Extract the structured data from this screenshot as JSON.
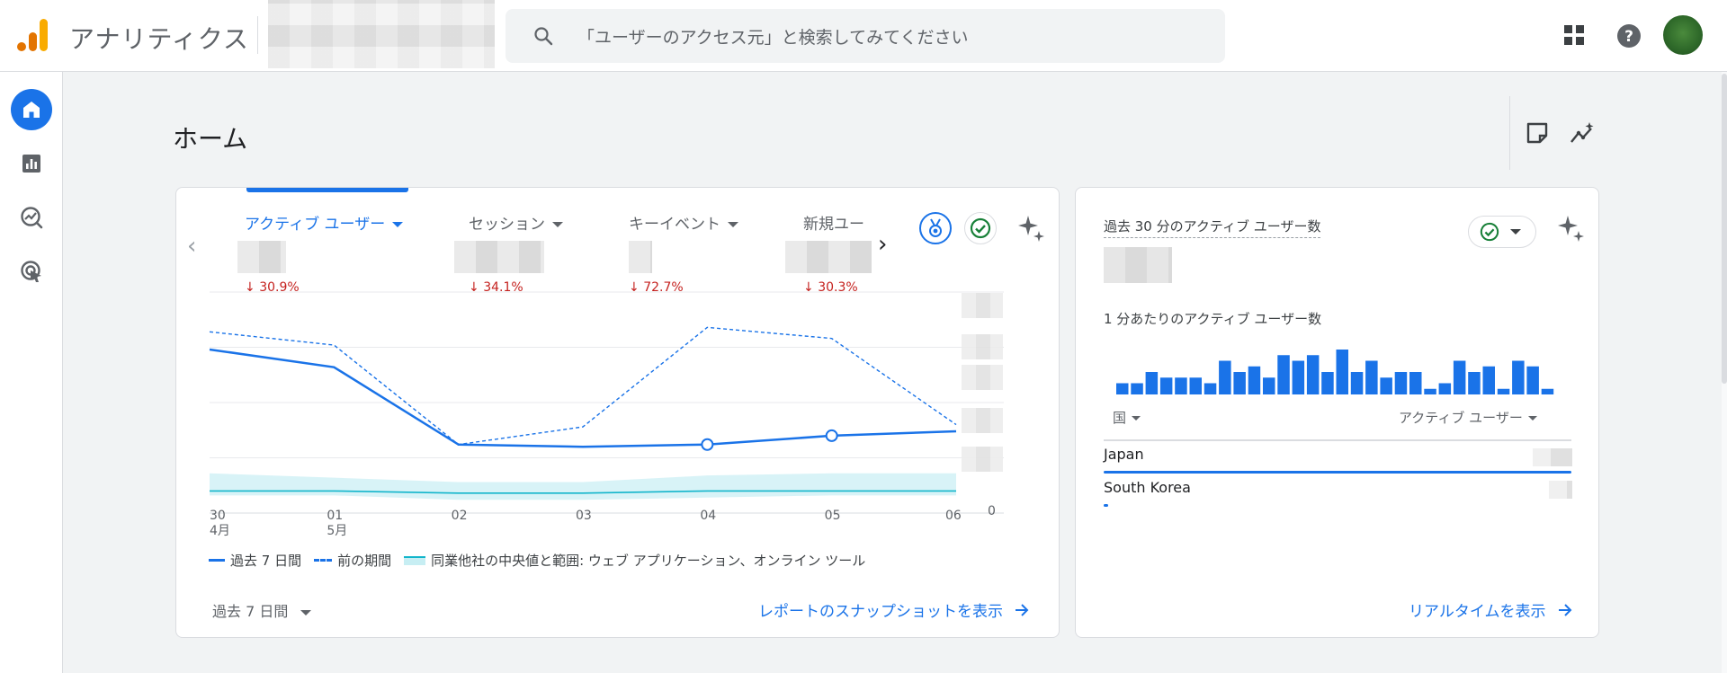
{
  "header": {
    "app_title": "アナリティクス",
    "search_placeholder": "「ユーザーのアクセス元」と検索してみてください",
    "icons": {
      "logo": "analytics-logo",
      "search": "search-icon",
      "apps": "apps-grid-icon",
      "help": "help-icon",
      "avatar": "avatar"
    }
  },
  "rail": {
    "items": [
      "home-icon",
      "reports-icon",
      "explore-icon",
      "advertising-icon"
    ]
  },
  "page": {
    "title": "ホーム"
  },
  "main_card": {
    "metrics": [
      {
        "label": "アクティブ ユーザー",
        "delta": "30.9%",
        "active": true
      },
      {
        "label": "セッション",
        "delta": "34.1%"
      },
      {
        "label": "キーイベント",
        "delta": "72.7%"
      },
      {
        "label": "新規ユー",
        "delta": "30.3%"
      }
    ],
    "y_zero_label": "0",
    "legend": {
      "current": "過去 7 日間",
      "previous": "前の期間",
      "benchmark": "同業他社の中央値と範囲: ウェブ アプリケーション、オンライン ツール"
    },
    "date_range": "過去 7 日間",
    "snapshot_link": "レポートのスナップショットを表示"
  },
  "chart_data": {
    "type": "line",
    "x": [
      {
        "day": "30",
        "month": "4月"
      },
      {
        "day": "01",
        "month": "5月"
      },
      {
        "day": "02",
        "month": ""
      },
      {
        "day": "03",
        "month": ""
      },
      {
        "day": "04",
        "month": ""
      },
      {
        "day": "05",
        "month": ""
      },
      {
        "day": "06",
        "month": ""
      }
    ],
    "ylim": [
      0,
      100
    ],
    "series": [
      {
        "name": "過去 7 日間",
        "style": "solid",
        "values": [
          74,
          66,
          31,
          30,
          31,
          35,
          37
        ]
      },
      {
        "name": "前の期間",
        "style": "dashed",
        "values": [
          82,
          76,
          31,
          39,
          84,
          79,
          40
        ]
      }
    ],
    "band": {
      "name": "同業他社の中央値と範囲: ウェブ アプリケーション、オンライン ツール",
      "low": [
        8,
        8,
        6,
        6,
        7,
        8,
        8
      ],
      "high": [
        18,
        16,
        14,
        14,
        17,
        18,
        18
      ],
      "median": [
        10,
        10,
        9,
        9,
        10,
        10,
        10
      ]
    },
    "colors": {
      "current": "#1a73e8",
      "previous": "#1a73e8",
      "band": "#c7eef3",
      "median": "#12b5cb"
    },
    "grid": true
  },
  "realtime": {
    "title": "過去 30 分のアクティブ ユーザー数",
    "per_minute_label": "1 分あたりのアクティブ ユーザー数",
    "per_minute_values": [
      2,
      2,
      4,
      3,
      3,
      3,
      2,
      6,
      4,
      5,
      3,
      7,
      6,
      7,
      4,
      8,
      4,
      6,
      3,
      4,
      4,
      1,
      2,
      6,
      4,
      5,
      1,
      6,
      5,
      1
    ],
    "col_country": "国",
    "col_users": "アクティブ ユーザー",
    "rows": [
      {
        "country": "Japan",
        "share": 1.0
      },
      {
        "country": "South Korea",
        "share": 0.01
      }
    ],
    "realtime_link": "リアルタイムを表示"
  }
}
